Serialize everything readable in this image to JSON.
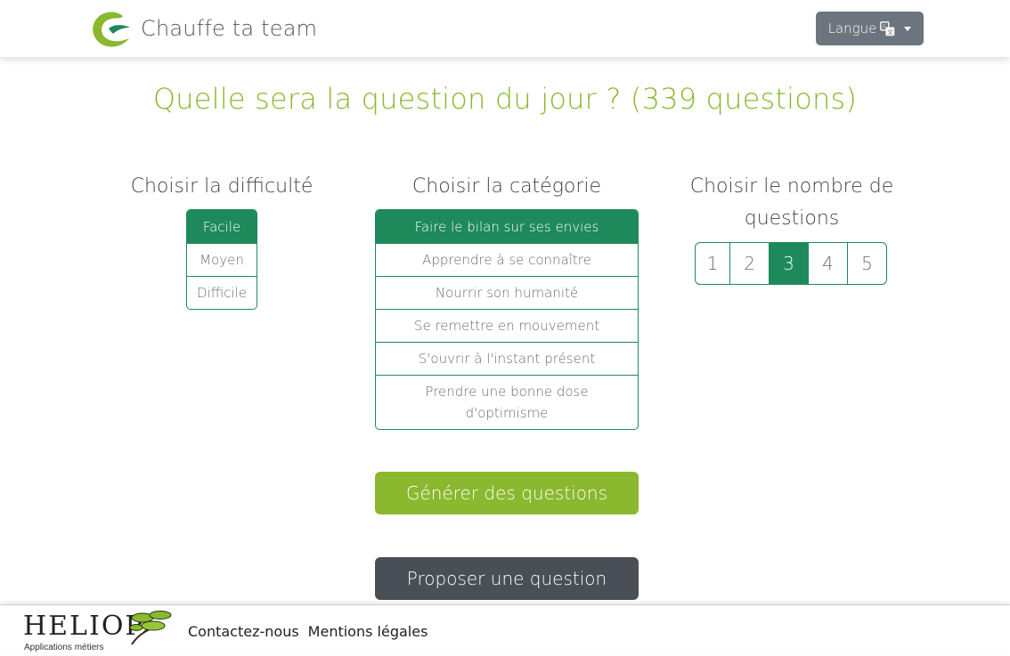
{
  "header": {
    "app_name": "Chauffe ta team",
    "language_button": "Langue"
  },
  "main": {
    "title": "Quelle sera la question du jour ? (339 questions)",
    "difficulty": {
      "heading": "Choisir la difficulté",
      "options": [
        "Facile",
        "Moyen",
        "Difficile"
      ],
      "selected": "Facile"
    },
    "category": {
      "heading": "Choisir la catégorie",
      "options": [
        "Faire le bilan sur ses envies",
        "Apprendre à se connaître",
        "Nourrir son humanité",
        "Se remettre en mouvement",
        "S'ouvrir à l'instant présent",
        "Prendre une bonne dose d'optimisme"
      ],
      "selected": "Faire le bilan sur ses envies"
    },
    "count": {
      "heading": "Choisir le nombre de questions",
      "options": [
        "1",
        "2",
        "3",
        "4",
        "5"
      ],
      "selected": "3"
    },
    "generate_button": "Générer des questions",
    "propose_button": "Proposer une question"
  },
  "footer": {
    "logo_text": "HELIOP",
    "logo_subtitle": "Applications métiers",
    "links": [
      "Contactez-nous",
      "Mentions légales"
    ]
  },
  "colors": {
    "accent_green": "#8ab82e",
    "selected_green": "#1e8a5b",
    "dark_button": "#4a4f57",
    "language_button": "#6c757d"
  },
  "icons": [
    "brand-logo-icon",
    "translate-icon",
    "chevron-down-icon",
    "heliop-tree-icon"
  ]
}
